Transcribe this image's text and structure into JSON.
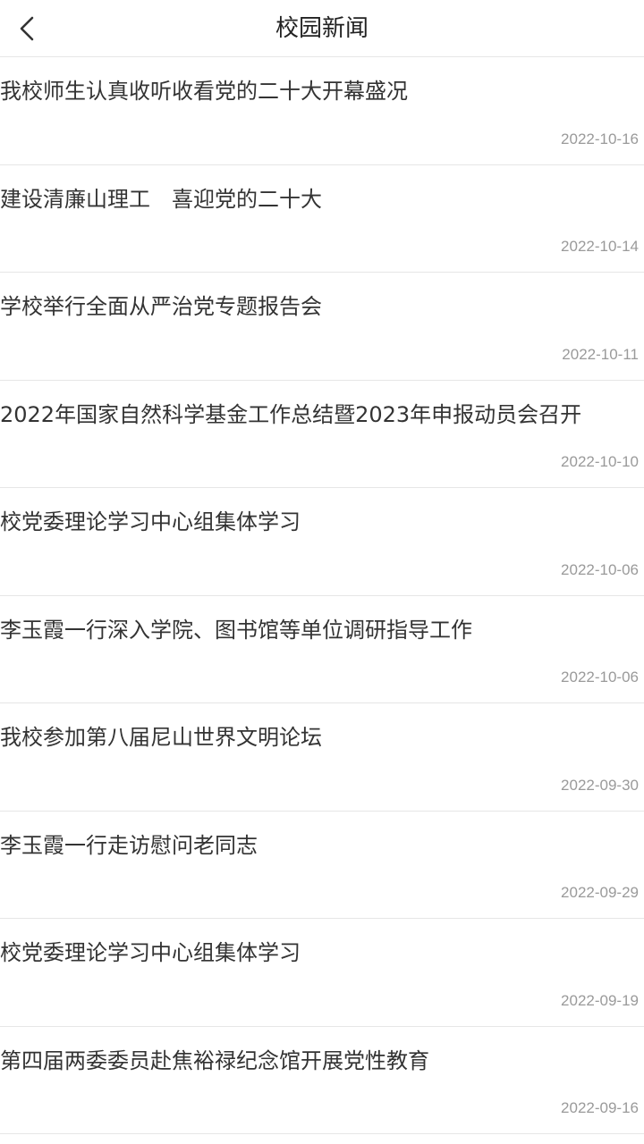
{
  "header": {
    "title": "校园新闻",
    "back_icon": "chevron-left-icon"
  },
  "news": [
    {
      "title": "我校师生认真收听收看党的二十大开幕盛况",
      "date": "2022-10-16"
    },
    {
      "title": "建设清廉山理工　喜迎党的二十大",
      "date": "2022-10-14"
    },
    {
      "title": "学校举行全面从严治党专题报告会",
      "date": "2022-10-11"
    },
    {
      "title": "2022年国家自然科学基金工作总结暨2023年申报动员会召开",
      "date": "2022-10-10"
    },
    {
      "title": "校党委理论学习中心组集体学习",
      "date": "2022-10-06"
    },
    {
      "title": "李玉霞一行深入学院、图书馆等单位调研指导工作",
      "date": "2022-10-06"
    },
    {
      "title": "我校参加第八届尼山世界文明论坛",
      "date": "2022-09-30"
    },
    {
      "title": "李玉霞一行走访慰问老同志",
      "date": "2022-09-29"
    },
    {
      "title": "校党委理论学习中心组集体学习",
      "date": "2022-09-19"
    },
    {
      "title": "第四届两委委员赴焦裕禄纪念馆开展党性教育",
      "date": "2022-09-16"
    }
  ]
}
